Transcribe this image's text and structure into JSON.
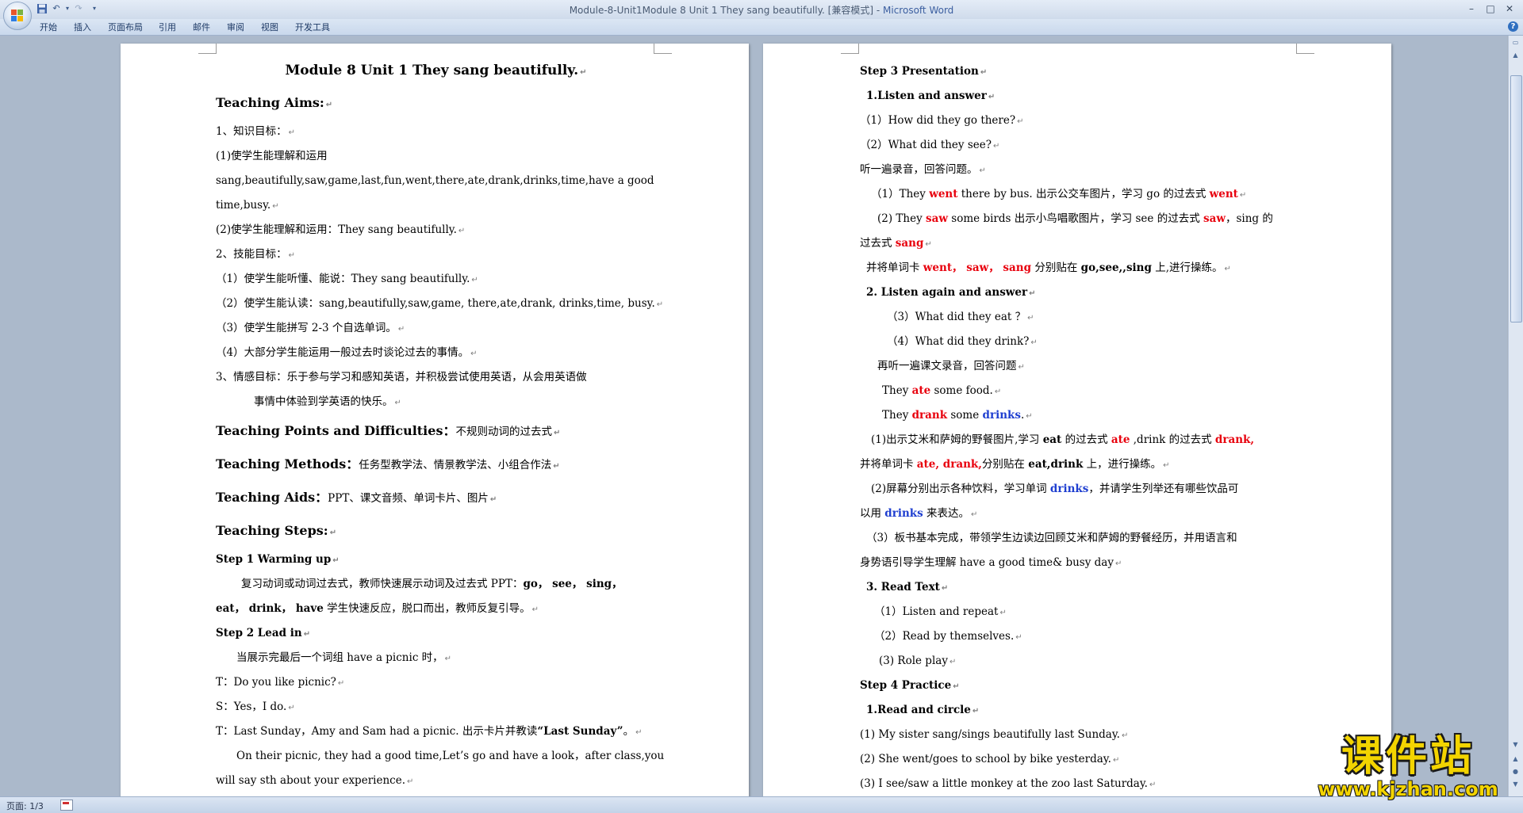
{
  "window": {
    "title": "Module-8-Unit1Module 8 Unit 1 They sang beautifully. [兼容模式]",
    "app": "Microsoft Word",
    "minimize_glyph": "–",
    "maximize_glyph": "□",
    "close_glyph": "✕"
  },
  "ribbon": {
    "tabs": [
      "开始",
      "插入",
      "页面布局",
      "引用",
      "邮件",
      "审阅",
      "视图",
      "开发工具"
    ],
    "help_glyph": "?"
  },
  "quick_access": [
    "save-icon",
    "undo-icon",
    "redo-icon",
    "customize-icon"
  ],
  "status": {
    "page": "页面: 1/3"
  },
  "watermark": {
    "chinese": "课件站",
    "url": "www.kjzhan.com"
  },
  "colors": {
    "highlight_red": "#e8000d",
    "highlight_blue": "#1f3fd0",
    "watermark_yellow": "#f3d400"
  },
  "left_page": {
    "title": "Module  8  Unit  1  They  sang  beautifully.",
    "aims_heading": "Teaching Aims:",
    "knowledge_label": "1、知识目标：",
    "k1": "(1)使学生能理解和运用",
    "k1_words_a": "sang,beautifully,saw,game,last,fun,went,there,ate,drank,drinks,time,have a good",
    "k1_words_b": "time,busy.",
    "k2": "(2)使学生能理解和运用：They sang beautifully.",
    "skill_label": "2、技能目标：",
    "s1": "（1）使学生能听懂、能说：They sang beautifully.",
    "s2": "（2）使学生能认读：sang,beautifully,saw,game, there,ate,drank, drinks,time, busy.",
    "s3": "（3）使学生能拼写 2-3 个自选单词。",
    "s4": "（4）大部分学生能运用一般过去时谈论过去的事情。",
    "emotion_a": "3、情感目标：乐于参与学习和感知英语，并积极尝试使用英语，从会用英语做",
    "emotion_b": "事情中体验到学英语的快乐。",
    "points_heading": "Teaching Points and Difficulties：",
    "points_value": "不规则动词的过去式",
    "methods_heading": "Teaching Methods：",
    "methods_value": "任务型教学法、情景教学法、小组合作法",
    "aids_heading": "Teaching Aids：",
    "aids_value": "PPT、课文音频、单词卡片、图片",
    "steps_heading": "Teaching Steps:",
    "step1": "Step 1 Warming up",
    "step1_a": "复习动词或动词过去式，教师快速展示动词及过去式 PPT：",
    "step1_a_bold": "go，  see，  sing，",
    "step1_b_bold": "eat，  drink，  have",
    "step1_b": " 学生快速反应，脱口而出，教师反复引导。",
    "step2": "Step 2 Lead in",
    "lead1": "当展示完最后一个词组 have a picnic 时，",
    "lead2": "T：Do you like picnic?",
    "lead3": "S：Yes，I do.",
    "lead4_a": "T：Last Sunday，Amy and Sam had a picnic.  出示卡片并教读",
    "lead4_bold": "“Last Sunday”",
    "lead4_b": "。",
    "lead5": "On their picnic, they had a good time,Let’s go and have a look，after class,you",
    "lead6": "will say sth about your experience."
  },
  "right_page": {
    "step3": "Step 3    Presentation",
    "la_heading": "1.Listen and answer",
    "q1": "（1）How did they go there?",
    "q2": "（2）What did they see?",
    "listen_once": "听一遍录音，回答问题。",
    "a1_pre": "（1）They ",
    "a1_red": "went",
    "a1_mid": " there by bus.  出示公交车图片，学习 go 的过去式 ",
    "a1_red2": "went",
    "a2_pre": "(2) They ",
    "a2_red": "saw",
    "a2_mid": " some birds 出示小鸟唱歌图片，学习 see 的过去式 ",
    "a2_red2": "saw",
    "a2_post": "，sing 的",
    "a2b_pre": "过去式 ",
    "a2b_red": "sang",
    "cards_pre": "并将单词卡 ",
    "cards_red": "went，  saw，  sang",
    "cards_mid": " 分别贴在 ",
    "cards_bold": "go,see,,sing",
    "cards_post": " 上,进行操练。",
    "lag_heading": "2. Listen again and answer",
    "q3": "（3）What did they eat  ？",
    "q4": "（4）What did they drink?",
    "listen_again": "再听一遍课文录音，回答问题",
    "ans_eat_pre": "They ",
    "ans_eat_red": "ate",
    "ans_eat_post": " some food.",
    "ans_drink_pre": "They ",
    "ans_drink_red": "drank",
    "ans_drink_mid": " some ",
    "ans_drink_blue": "drinks",
    "ans_drink_post": ".",
    "p1_pre": "(1)出示艾米和萨姆的野餐图片,学习 ",
    "p1_bold": "eat",
    "p1_mid": " 的过去式 ",
    "p1_red": "ate",
    "p1_mid2": "  ,drink 的过去式 ",
    "p1_red2": "drank,",
    "p1b_pre": "并将单词卡 ",
    "p1b_red": "ate, drank,",
    "p1b_mid": "分别贴在 ",
    "p1b_bold": "eat,drink",
    "p1b_post": " 上，进行操练。",
    "p2_pre": "(2)屏幕分别出示各种饮料，学习单词 ",
    "p2_blue": "drinks",
    "p2_post": "，并请学生列举还有哪些饮品可",
    "p2b_pre": "以用 ",
    "p2b_blue": "drinks",
    "p2b_post": " 来表达。",
    "p3_a": "（3）板书基本完成，带领学生边读边回顾艾米和萨姆的野餐经历，并用语言和",
    "p3_b": "身势语引导学生理解 have a good time& busy day",
    "rt_heading": "3. Read Text",
    "rt1": "（1）Listen and repeat",
    "rt2": "（2）Read by themselves.",
    "rt3": "(3) Role play",
    "step4": "Step 4 Practice",
    "rc_heading": "1.Read and circle",
    "ex1": "(1) My sister          sang/sings beautifully last Sunday.",
    "ex2": "(2) She         went/goes to school by bike yesterday.",
    "ex3": "(3) I          see/saw a little monkey at the zoo last Saturday."
  }
}
